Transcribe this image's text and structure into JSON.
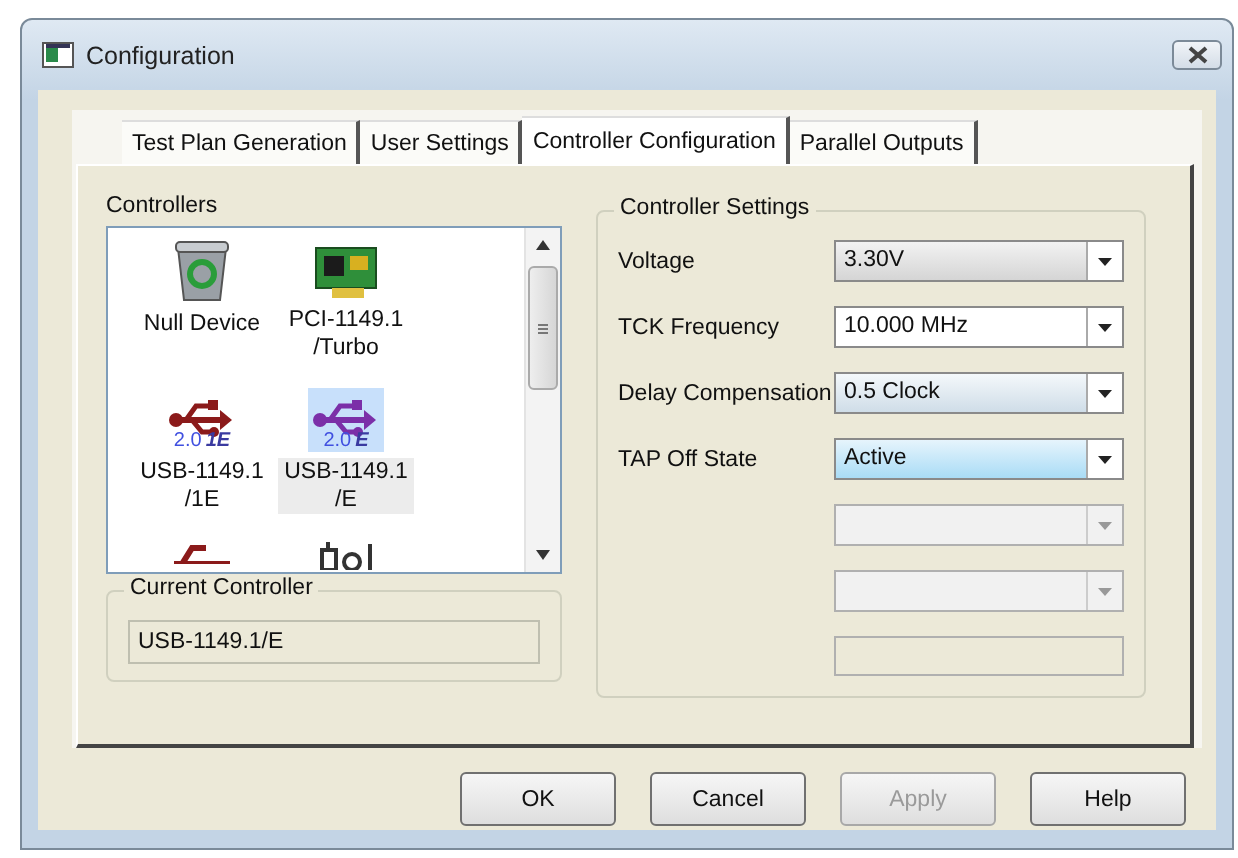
{
  "window": {
    "title": "Configuration"
  },
  "tabs": [
    {
      "label": "Test Plan Generation",
      "selected": false
    },
    {
      "label": "User Settings",
      "selected": false
    },
    {
      "label": "Controller Configuration",
      "selected": true
    },
    {
      "label": "Parallel Outputs",
      "selected": false
    }
  ],
  "controllers": {
    "title": "Controllers",
    "items": [
      {
        "kind": "trash",
        "label": [
          "Null Device"
        ],
        "selected": false
      },
      {
        "kind": "pci-card",
        "label": [
          "PCI-1149.1",
          "/Turbo"
        ],
        "selected": false
      },
      {
        "kind": "usb",
        "color": "#8b1a1a",
        "badge": "2.0",
        "edition": "1E",
        "label": [
          "USB-1149.1",
          "/1E"
        ],
        "selected": false
      },
      {
        "kind": "usb",
        "color": "#7b2fa8",
        "badge": "2.0",
        "edition": "E",
        "label": [
          "USB-1149.1",
          "/E"
        ],
        "selected": true
      },
      {
        "kind": "usb-partial",
        "color": "#8b1a1a",
        "selected": false
      },
      {
        "kind": "probe-partial",
        "selected": false
      }
    ]
  },
  "current_controller": {
    "title": "Current Controller",
    "value": "USB-1149.1/E"
  },
  "controller_settings": {
    "title": "Controller Settings",
    "rows": [
      {
        "kind": "combo",
        "label": "Voltage",
        "value": "3.30V",
        "disabled": false
      },
      {
        "kind": "combo",
        "label": "TCK Frequency",
        "value": "10.000 MHz",
        "disabled": false
      },
      {
        "kind": "combo",
        "label": "Delay Compensation",
        "value": "0.5 Clock",
        "disabled": false
      },
      {
        "kind": "combo",
        "label": "TAP Off State",
        "value": "Active",
        "disabled": false
      },
      {
        "kind": "combo",
        "disabled": true
      },
      {
        "kind": "combo",
        "disabled": true
      },
      {
        "kind": "text",
        "disabled": true
      }
    ]
  },
  "buttons": [
    {
      "label": "OK",
      "disabled": false
    },
    {
      "label": "Cancel",
      "disabled": false
    },
    {
      "label": "Apply",
      "disabled": true
    },
    {
      "label": "Help",
      "disabled": false
    }
  ]
}
